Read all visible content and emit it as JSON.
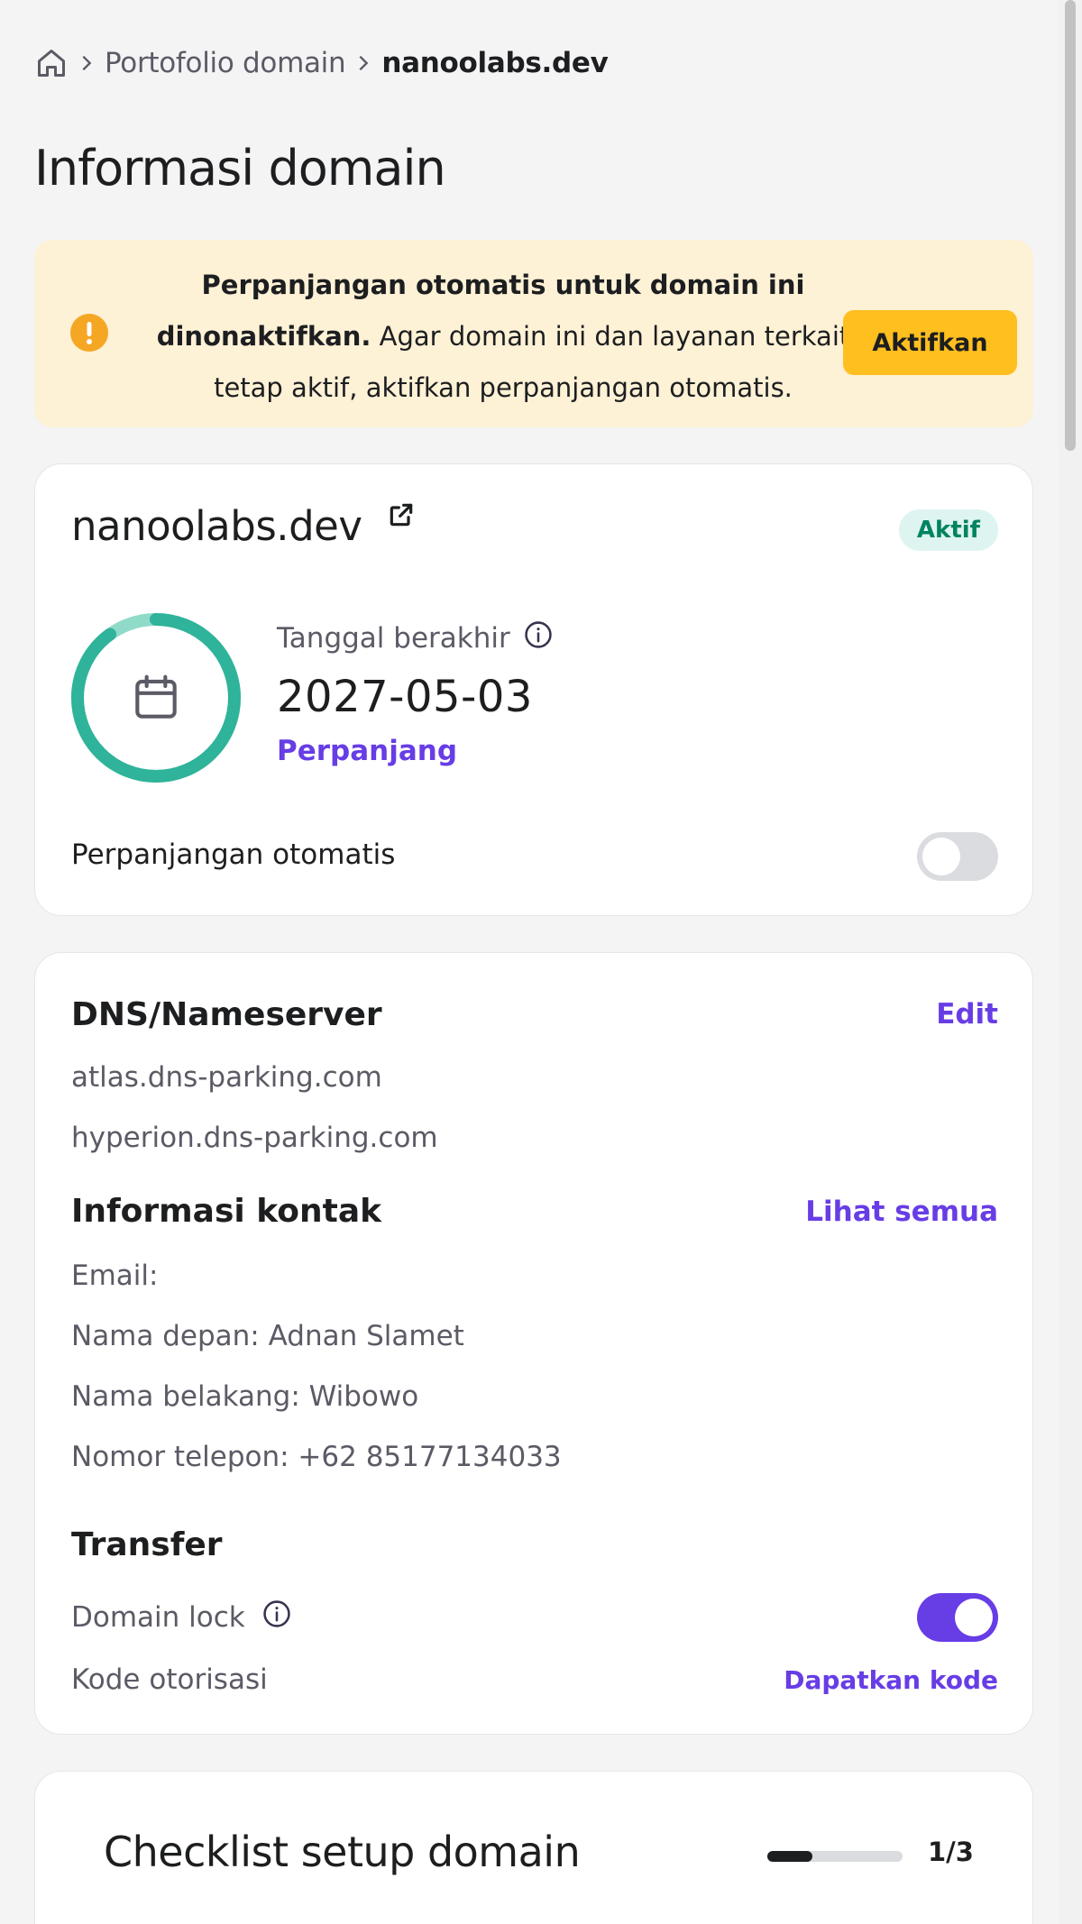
{
  "breadcrumb": {
    "home_icon": "home-icon",
    "portfolio": "Portofolio domain",
    "current": "nanoolabs.dev"
  },
  "page_title": "Informasi domain",
  "alert": {
    "bold_text": "Perpanjangan otomatis untuk domain ini dinonaktifkan.",
    "body_text": " Agar domain ini dan layanan terkait tetap aktif, aktifkan perpanjangan otomatis.",
    "button_label": "Aktifkan",
    "icon": "warning-icon",
    "color": "#fdf1d6",
    "button_color": "#ffbf1f"
  },
  "domain_card": {
    "domain": "nanoolabs.dev",
    "status": "Aktif",
    "expiry_label": "Tanggal berakhir",
    "expiry_date": "2027-05-03",
    "renew_label": "Perpanjang",
    "auto_renew_label": "Perpanjangan otomatis",
    "auto_renew_enabled": false,
    "ring_progress": 0.9
  },
  "dns": {
    "title": "DNS/Nameserver",
    "edit_label": "Edit",
    "nameservers": [
      "atlas.dns-parking.com",
      "hyperion.dns-parking.com"
    ]
  },
  "contact": {
    "title": "Informasi kontak",
    "view_all_label": "Lihat semua",
    "email": "Email:",
    "first_name": "Nama depan: Adnan Slamet",
    "last_name": "Nama belakang: Wibowo",
    "phone": "Nomor telepon: +62 85177134033"
  },
  "transfer": {
    "title": "Transfer",
    "domain_lock_label": "Domain lock",
    "domain_lock_enabled": true,
    "auth_code_label": "Kode otorisasi",
    "get_code_label": "Dapatkan kode"
  },
  "checklist": {
    "title": "Checklist setup domain",
    "progress_text": "1/3",
    "progress": 0.3333
  },
  "colors": {
    "accent": "#673de6",
    "success": "#008361",
    "ring": "#2fb39a"
  }
}
